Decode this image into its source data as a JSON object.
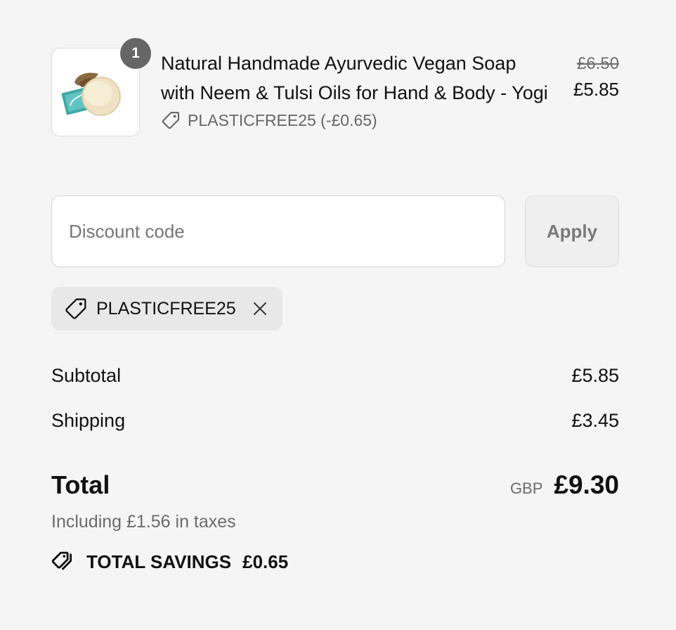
{
  "product": {
    "quantity": "1",
    "title": "Natural Handmade Ayurvedic Vegan Soap with Neem & Tulsi Oils for Hand & Body - Yogi",
    "discount_line": "PLASTICFREE25 (-£0.65)",
    "price_original": "£6.50",
    "price_discounted": "£5.85",
    "image_alt": "Yogi soap bar"
  },
  "discount_form": {
    "placeholder": "Discount code",
    "value": "",
    "apply_label": "Apply"
  },
  "applied_code": {
    "code": "PLASTICFREE25"
  },
  "totals": {
    "subtotal_label": "Subtotal",
    "subtotal_value": "£5.85",
    "shipping_label": "Shipping",
    "shipping_value": "£3.45",
    "total_label": "Total",
    "currency": "GBP",
    "total_value": "£9.30",
    "taxes_note": "Including £1.56 in taxes",
    "savings_label": "TOTAL SAVINGS",
    "savings_value": "£0.65"
  },
  "icons": {
    "discount_tag": "tag-icon",
    "remove": "close-icon",
    "savings": "tags-icon"
  },
  "colors": {
    "background": "#f5f5f5",
    "badge": "#666666",
    "chip": "#e8e8e8",
    "muted_text": "#6b6b6b"
  }
}
